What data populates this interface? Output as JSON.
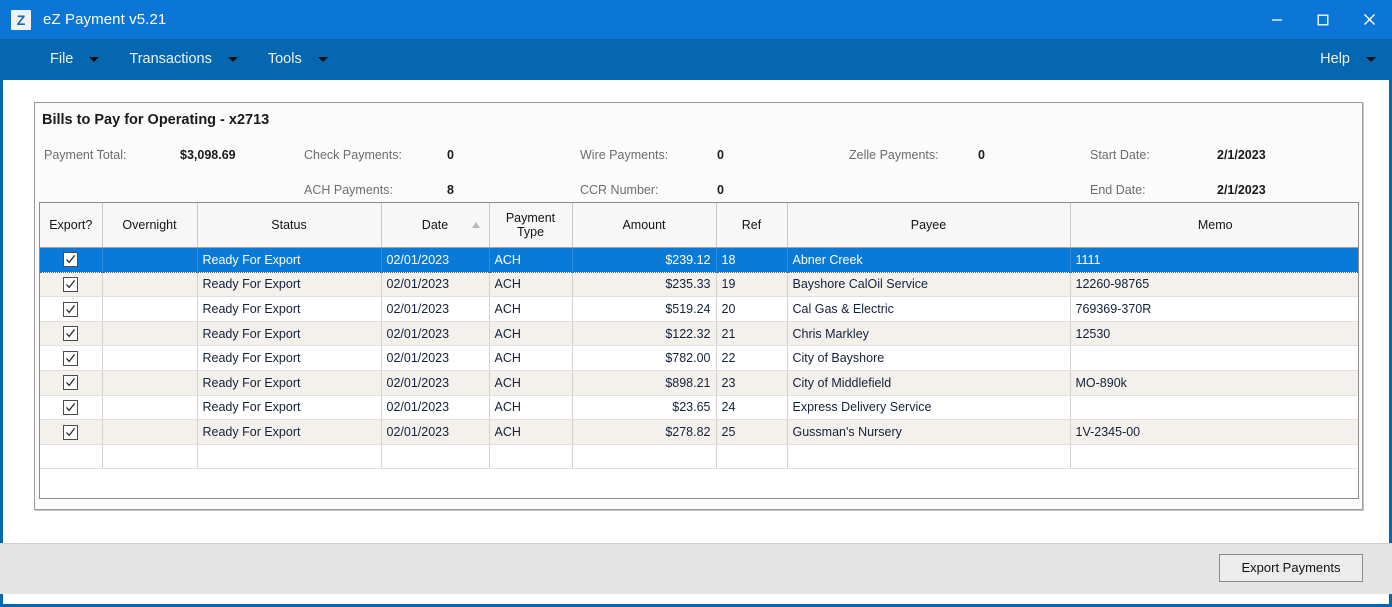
{
  "window": {
    "logo_letter": "Z",
    "title": "eZ Payment v5.21",
    "controls": {
      "minimize": "minimize-icon",
      "maximize": "maximize-icon",
      "close": "close-icon"
    }
  },
  "menubar": {
    "items": [
      {
        "label": "File",
        "has_caret": true
      },
      {
        "label": "Transactions",
        "has_caret": true
      },
      {
        "label": "Tools",
        "has_caret": true
      }
    ],
    "right_items": [
      {
        "label": "Help",
        "has_caret": true
      }
    ]
  },
  "panel": {
    "title_main": "Bills to Pay for Operating",
    "title_sep": " - ",
    "title_account": "x2713",
    "summary": {
      "payment_total_label": "Payment Total:",
      "payment_total_value": "$3,098.69",
      "check_payments_label": "Check Payments:",
      "check_payments_value": "0",
      "ach_payments_label": "ACH Payments:",
      "ach_payments_value": "8",
      "wire_payments_label": "Wire Payments:",
      "wire_payments_value": "0",
      "ccr_number_label": "CCR Number:",
      "ccr_number_value": "0",
      "zelle_payments_label": "Zelle Payments:",
      "zelle_payments_value": "0",
      "start_date_label": "Start Date:",
      "start_date_value": "2/1/2023",
      "end_date_label": "End Date:",
      "end_date_value": "2/1/2023"
    }
  },
  "grid": {
    "columns": [
      {
        "key": "export",
        "label": "Export?",
        "sorted": false
      },
      {
        "key": "overnight",
        "label": "Overnight",
        "sorted": false
      },
      {
        "key": "status",
        "label": "Status",
        "sorted": false
      },
      {
        "key": "date",
        "label": "Date",
        "sorted": true,
        "sort_dir": "asc"
      },
      {
        "key": "paytype",
        "label": "Payment Type",
        "sorted": false
      },
      {
        "key": "amount",
        "label": "Amount",
        "sorted": false
      },
      {
        "key": "ref",
        "label": "Ref",
        "sorted": false
      },
      {
        "key": "payee",
        "label": "Payee",
        "sorted": false
      },
      {
        "key": "memo",
        "label": "Memo",
        "sorted": false
      }
    ],
    "rows": [
      {
        "export": true,
        "overnight": "",
        "status": "Ready For Export",
        "date": "02/01/2023",
        "paytype": "ACH",
        "amount": "$239.12",
        "ref": "18",
        "payee": "Abner Creek",
        "memo": "1111",
        "selected": true
      },
      {
        "export": true,
        "overnight": "",
        "status": "Ready For Export",
        "date": "02/01/2023",
        "paytype": "ACH",
        "amount": "$235.33",
        "ref": "19",
        "payee": "Bayshore CalOil Service",
        "memo": "12260-98765",
        "selected": false
      },
      {
        "export": true,
        "overnight": "",
        "status": "Ready For Export",
        "date": "02/01/2023",
        "paytype": "ACH",
        "amount": "$519.24",
        "ref": "20",
        "payee": "Cal Gas & Electric",
        "memo": "769369-370R",
        "selected": false
      },
      {
        "export": true,
        "overnight": "",
        "status": "Ready For Export",
        "date": "02/01/2023",
        "paytype": "ACH",
        "amount": "$122.32",
        "ref": "21",
        "payee": "Chris Markley",
        "memo": "12530",
        "selected": false
      },
      {
        "export": true,
        "overnight": "",
        "status": "Ready For Export",
        "date": "02/01/2023",
        "paytype": "ACH",
        "amount": "$782.00",
        "ref": "22",
        "payee": "City of Bayshore",
        "memo": "",
        "selected": false
      },
      {
        "export": true,
        "overnight": "",
        "status": "Ready For Export",
        "date": "02/01/2023",
        "paytype": "ACH",
        "amount": "$898.21",
        "ref": "23",
        "payee": "City of Middlefield",
        "memo": "MO-890k",
        "selected": false
      },
      {
        "export": true,
        "overnight": "",
        "status": "Ready For Export",
        "date": "02/01/2023",
        "paytype": "ACH",
        "amount": "$23.65",
        "ref": "24",
        "payee": "Express Delivery Service",
        "memo": "",
        "selected": false
      },
      {
        "export": true,
        "overnight": "",
        "status": "Ready For Export",
        "date": "02/01/2023",
        "paytype": "ACH",
        "amount": "$278.82",
        "ref": "25",
        "payee": "Gussman's Nursery",
        "memo": "1V-2345-00",
        "selected": false
      }
    ]
  },
  "footer": {
    "export_button_label": "Export Payments"
  },
  "colors": {
    "titlebar": "#0b76d6",
    "menubar": "#0567b0",
    "selection": "#0a7ad8",
    "row_alt": "#f4f1ed",
    "footer": "#e4e4e4"
  }
}
